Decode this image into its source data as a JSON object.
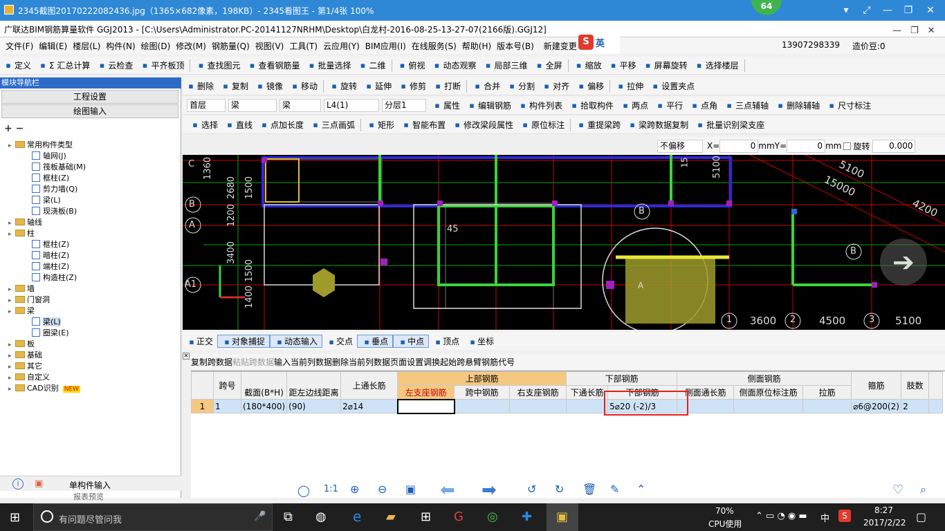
{
  "viewer": {
    "title": "2345截图20170222082436.jpg（1365×682像素，198KB）- 2345看图王 - 第1/4张 100%",
    "badge": "64"
  },
  "app": {
    "title": "广联达BIM钢筋算量软件 GGJ2013 - [C:\\Users\\Administrator.PC-20141127NRHM\\Desktop\\白龙村-2016-08-25-13-27-07(2166版).GGJ12]"
  },
  "menu": [
    "文件(F)",
    "编辑(E)",
    "楼层(L)",
    "构件(N)",
    "绘图(D)",
    "修改(M)",
    "钢筋量(Q)",
    "视图(V)",
    "工具(T)",
    "云应用(Y)",
    "BIM应用(I)",
    "在线服务(S)",
    "帮助(H)",
    "版本号(B)"
  ],
  "menu_right": {
    "new_change": "新建变更",
    "phone": "13907298339",
    "bean": "造价豆:0",
    "ime": "英"
  },
  "toolbar1": [
    "定义",
    "Σ 汇总计算",
    "云检查",
    "平齐板顶",
    "查找图元",
    "查看钢筋量",
    "批量选择",
    "二维",
    "俯视",
    "动态观察",
    "局部三维",
    "全屏",
    "缩放",
    "平移",
    "屏幕旋转",
    "选择楼层"
  ],
  "toolbar2": [
    "删除",
    "复制",
    "镜像",
    "移动",
    "旋转",
    "延伸",
    "修剪",
    "打断",
    "合并",
    "分割",
    "对齐",
    "偏移",
    "拉伸",
    "设置夹点"
  ],
  "toolbar3": {
    "floor": "首层",
    "type1": "梁",
    "type2": "梁",
    "member": "L4(1)",
    "layer": "分层1",
    "items": [
      "属性",
      "编辑钢筋",
      "构件列表",
      "拾取构件",
      "两点",
      "平行",
      "点角",
      "三点辅轴",
      "删除辅轴",
      "尺寸标注"
    ]
  },
  "toolbar4": [
    "选择",
    "直线",
    "点加长度",
    "三点画弧",
    "矩形",
    "智能布置",
    "修改梁段属性",
    "原位标注",
    "重提梁跨",
    "梁跨数据复制",
    "批量识别梁支座"
  ],
  "coordbar": {
    "offset": "不偏移",
    "x_label": "X=",
    "x": "0",
    "y_label": "Y=",
    "y": "0",
    "unit": "mm",
    "rotate": "旋转",
    "angle": "0.000"
  },
  "leftpanel": {
    "header": "模块导航栏",
    "tab1": "工程设置",
    "tab2": "绘图输入",
    "tree": [
      {
        "text": "常用构件类型",
        "level": 0,
        "folder": true
      },
      {
        "text": "轴网(J)",
        "level": 1
      },
      {
        "text": "筏板基础(M)",
        "level": 1
      },
      {
        "text": "框柱(Z)",
        "level": 1
      },
      {
        "text": "剪力墙(Q)",
        "level": 1
      },
      {
        "text": "梁(L)",
        "level": 1
      },
      {
        "text": "现浇板(B)",
        "level": 1
      },
      {
        "text": "轴线",
        "level": 0,
        "folder": true
      },
      {
        "text": "柱",
        "level": 0,
        "folder": true
      },
      {
        "text": "框柱(Z)",
        "level": 1
      },
      {
        "text": "暗柱(Z)",
        "level": 1
      },
      {
        "text": "端柱(Z)",
        "level": 1
      },
      {
        "text": "构造柱(Z)",
        "level": 1
      },
      {
        "text": "墙",
        "level": 0,
        "folder": true
      },
      {
        "text": "门窗洞",
        "level": 0,
        "folder": true
      },
      {
        "text": "梁",
        "level": 0,
        "folder": true
      },
      {
        "text": "梁(L)",
        "level": 1
      },
      {
        "text": "圈梁(E)",
        "level": 1
      },
      {
        "text": "板",
        "level": 0,
        "folder": true
      },
      {
        "text": "基础",
        "level": 0,
        "folder": true
      },
      {
        "text": "其它",
        "level": 0,
        "folder": true
      },
      {
        "text": "自定义",
        "level": 0,
        "folder": true
      },
      {
        "text": "CAD识别",
        "level": 0,
        "folder": true
      }
    ],
    "new_badge": "NEW",
    "bottom": "单构件输入",
    "bottom2": "报表预览"
  },
  "cad_labels": {
    "axes_left": [
      "C",
      "B",
      "A",
      "A1"
    ],
    "dims_left": [
      "1360",
      "2680",
      "1500",
      "1200",
      "3400",
      "1500",
      "1400"
    ],
    "top_right": [
      "5100",
      "15000",
      "4200"
    ],
    "bottom_axes": [
      "1",
      "2",
      "3"
    ],
    "bottom_dims": [
      "3600",
      "4500",
      "5100"
    ],
    "misc": [
      "45",
      "B",
      "B",
      "A",
      "5100",
      "15"
    ]
  },
  "snapbar": [
    "正交",
    "对象捕捉",
    "动态输入",
    "交点",
    "垂点",
    "中点",
    "顶点",
    "坐标"
  ],
  "gridtoolbar": [
    "复制跨数据",
    "粘贴跨数据",
    "输入当前列数据",
    "删除当前列数据",
    "页面设置",
    "调换起始跨",
    "悬臂钢筋代号"
  ],
  "grid": {
    "header_groups": {
      "top": "上部钢筋",
      "bottom": "下部钢筋",
      "side": "侧面钢筋"
    },
    "columns": [
      "跨号",
      "截面(B*H)",
      "距左边线距离",
      "上通长筋",
      "左支座钢筋",
      "跨中钢筋",
      "右支座钢筋",
      "下通长筋",
      "下部钢筋",
      "侧面通长筋",
      "侧面原位标注筋",
      "拉筋",
      "箍筋",
      "肢数"
    ],
    "rows": [
      {
        "idx": "1",
        "span": "1",
        "section": "(180*400)",
        "dist": "(90)",
        "top_through": "2⌀14",
        "left": "",
        "mid": "",
        "right": "",
        "bot_through": "",
        "bottom": "5⌀20 (-2)/3",
        "side_through": "",
        "side_mark": "",
        "tie": "",
        "stirrup": "⌀6@200(2)",
        "legs": "2"
      }
    ]
  },
  "taskbar": {
    "search": "有问题尽管问我",
    "cpu_pct": "70%",
    "cpu_label": "CPU使用",
    "time": "8:27",
    "date": "2017/2/22",
    "ime": "中"
  }
}
